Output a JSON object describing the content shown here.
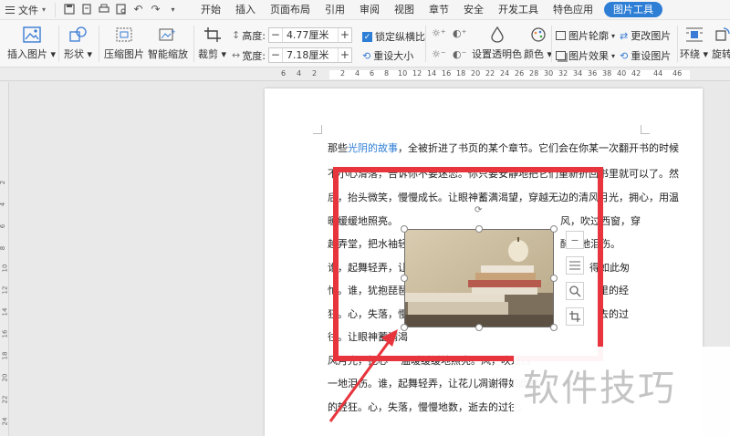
{
  "menu": {
    "file_label": "文件",
    "tabs": [
      "开始",
      "插入",
      "页面布局",
      "引用",
      "审阅",
      "视图",
      "章节",
      "安全",
      "开发工具",
      "特色应用",
      "图片工具"
    ],
    "active_tab": "图片工具"
  },
  "ribbon": {
    "insert_image": "插入图片",
    "shape": "形状",
    "compress": "压缩图片",
    "smart_zoom": "智能缩放",
    "crop": "裁剪",
    "height_label": "高度:",
    "height_value": "4.77厘米",
    "width_label": "宽度:",
    "width_value": "7.18厘米",
    "lock_ratio": "锁定纵横比",
    "reset_size": "重设大小",
    "set_transparent": "设置透明色",
    "color": "颜色",
    "outline": "图片轮廓",
    "effect": "图片效果",
    "change_image": "更改图片",
    "reset_image": "重设图片",
    "wrap": "环绕",
    "rotate": "旋转",
    "minus": "−",
    "plus": "+"
  },
  "ruler": {
    "ticks": [
      "6",
      "4",
      "2",
      "2",
      "4",
      "6",
      "8",
      "10",
      "12",
      "14",
      "16",
      "18",
      "20",
      "22",
      "24",
      "26",
      "28",
      "30",
      "32",
      "34",
      "36",
      "38",
      "40",
      "42",
      "44",
      "46"
    ],
    "vticks": [
      "2",
      "4",
      "6",
      "8",
      "10",
      "12",
      "14",
      "16",
      "18",
      "20",
      "22",
      "24"
    ]
  },
  "document": {
    "line1_prefix": "那些",
    "line1_link": "光阴的故事",
    "line1_suffix": "，全被折进了书页的某个章节。它们会在你某一次翻开书的时候",
    "line2": "不小心滑落，告诉你不要迷恋。你只要安静地把它们重新折回书里就可以了。然",
    "line3": "后，抬头微笑，慢慢成长。让眼神蓄满渴望，穿越无边的清风月光，拥心，用温",
    "line4_left": "暖缓缓地照亮。",
    "line4_right": "风，吹过西窗，穿",
    "line5_left": "越弄堂，把水袖轻",
    "line5_right": "醉一地泪伤。",
    "line6_left": "谁，起舞轻弄，让",
    "line6_right": "得如此匆",
    "line7_left": "忙。谁，犹抱琵琶",
    "line7_right": "里的经",
    "line8_left": "狂。心，失落，慢",
    "line8_right": "去的过",
    "line9_left": "往。让眼神蓄满渴",
    "line10": "风月光，把心",
    "line10_b": "温暖缓缓地照亮。风，吹过西",
    "line11": "一地泪伤。谁，起舞轻弄，让花儿凋谢得如此匆",
    "line12": "的轻狂。心，失落，慢慢地数，逝去的过往。"
  },
  "watermark": "软件技巧"
}
